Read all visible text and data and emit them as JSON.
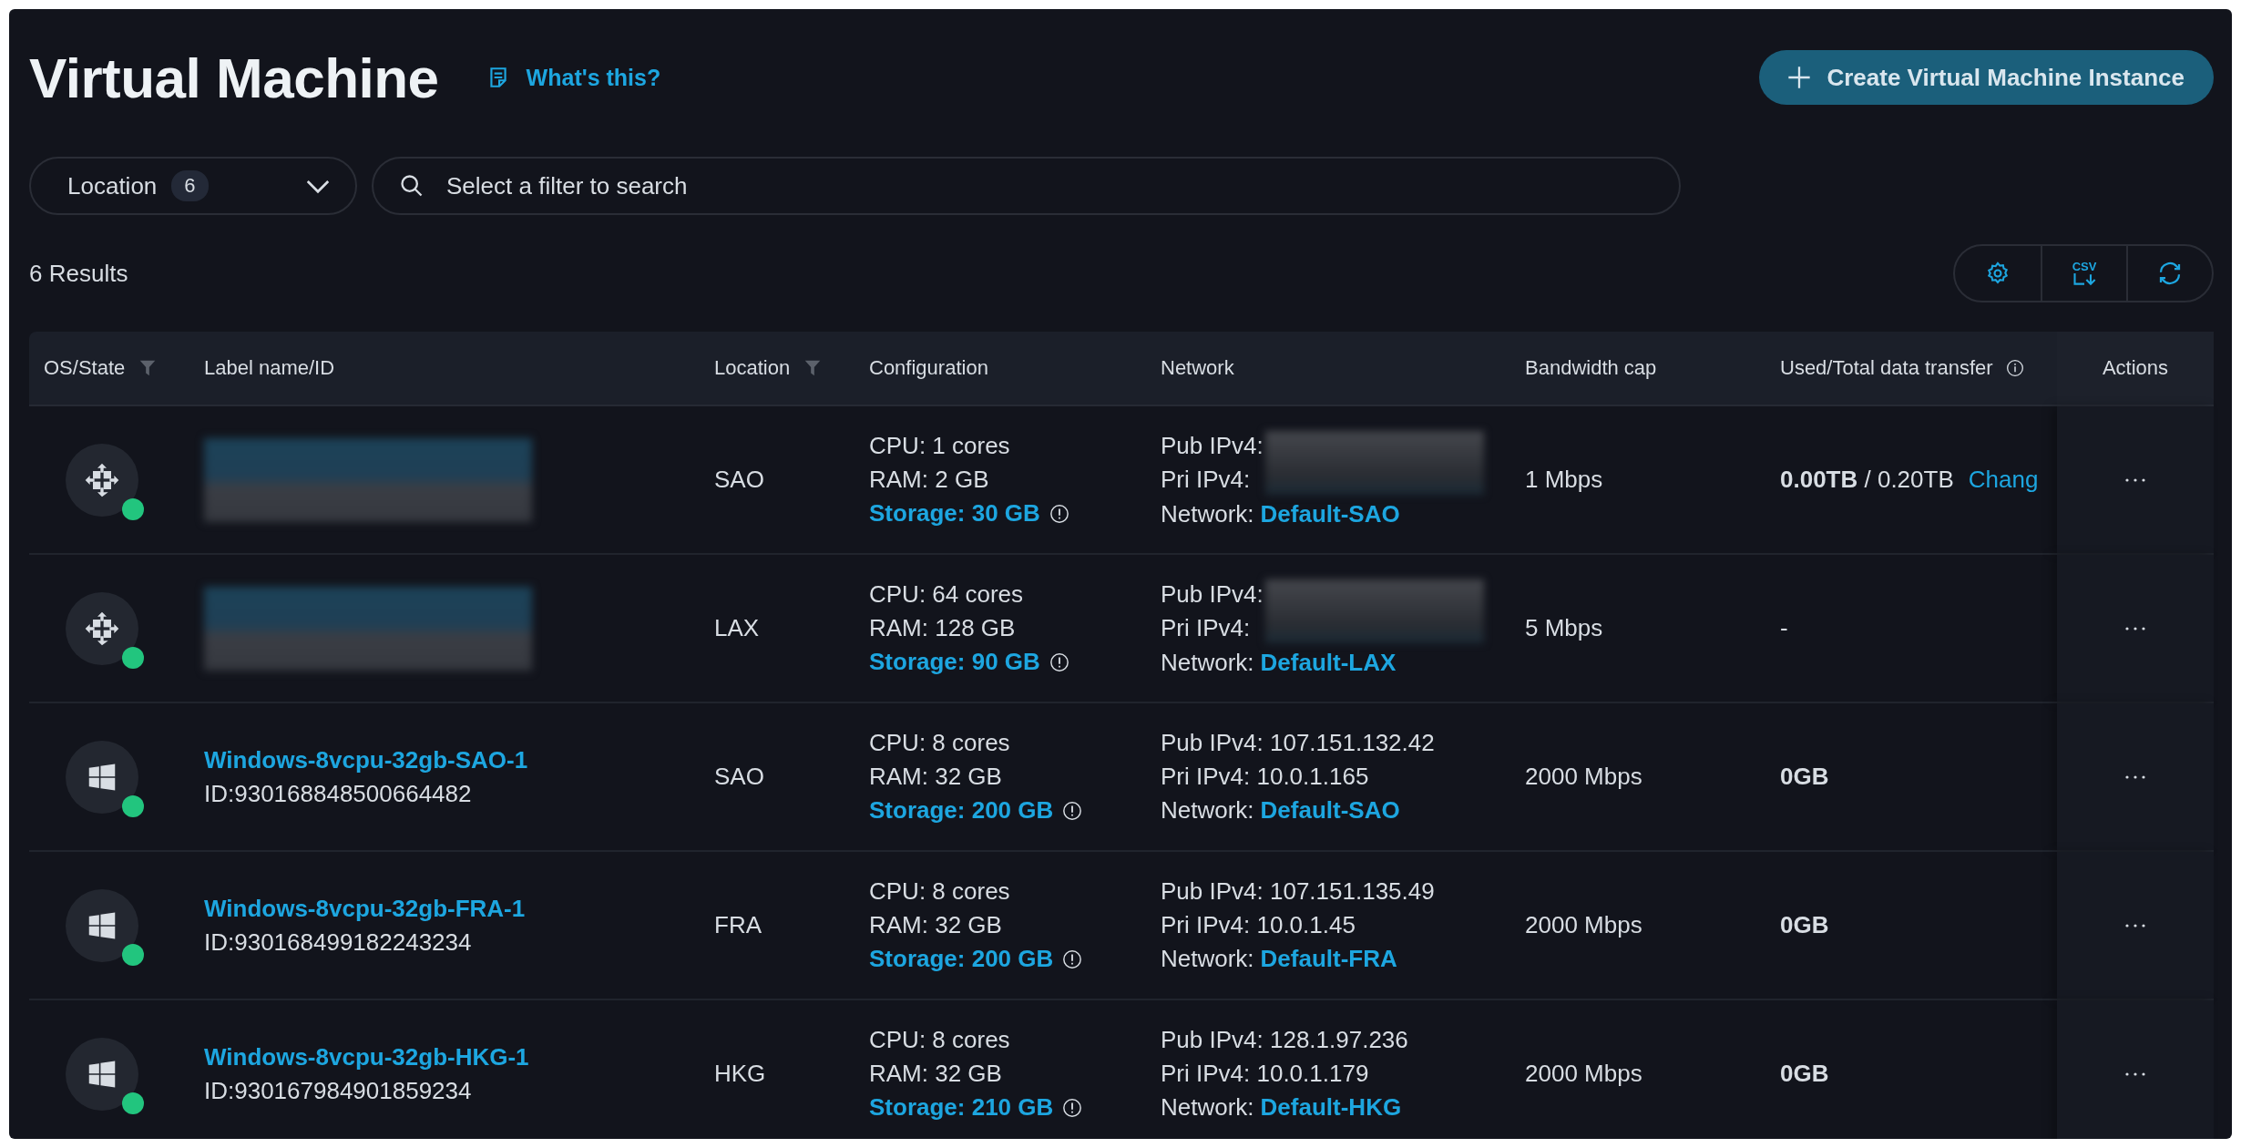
{
  "header": {
    "title": "Virtual Machine",
    "help_link": "What's this?",
    "create_button": "Create Virtual Machine Instance"
  },
  "filters": {
    "location": {
      "label": "Location",
      "count": "6"
    },
    "search": {
      "placeholder": "Select a filter to search"
    }
  },
  "results": "6 Results",
  "toolbar": [
    {
      "kind": "settings"
    },
    {
      "kind": "export",
      "label": "CSV"
    },
    {
      "kind": "refresh"
    }
  ],
  "table": {
    "columns": [
      {
        "label": "OS/State",
        "kind": "filterable"
      },
      {
        "label": "Label name/ID",
        "kind": "plain"
      },
      {
        "label": "Location",
        "kind": "filterable"
      },
      {
        "label": "Configuration",
        "kind": "plain"
      },
      {
        "label": "Network",
        "kind": "plain"
      },
      {
        "label": "Bandwidth cap",
        "kind": "plain"
      },
      {
        "label": "Used/Total data transfer",
        "kind": "explained"
      },
      {
        "label": "Actions",
        "kind": "centered"
      }
    ],
    "rows": [
      {
        "kind": "generic",
        "running": true,
        "name_redacted": true,
        "location": "SAO",
        "cpu": "CPU: 1 cores",
        "ram": "RAM: 2 GB",
        "storage": "Storage: 30 GB",
        "pub_ip": "Pub IPv4:",
        "pri_ip": "Pri IPv4:",
        "ip_redacted": true,
        "network_label": "Network:",
        "network": "Default-SAO",
        "bandwidth": "1 Mbps",
        "transfer": {
          "used": "0.00TB",
          "total": "/ 0.20TB",
          "link": "Chang"
        }
      },
      {
        "kind": "generic",
        "running": true,
        "name_redacted": true,
        "location": "LAX",
        "cpu": "CPU: 64 cores",
        "ram": "RAM: 128 GB",
        "storage": "Storage: 90 GB",
        "pub_ip": "Pub IPv4:",
        "pri_ip": "Pri IPv4:",
        "ip_redacted": true,
        "network_label": "Network:",
        "network": "Default-LAX",
        "bandwidth": "5 Mbps",
        "transfer": {
          "text": "-"
        }
      },
      {
        "kind": "windows",
        "running": true,
        "name_redacted": false,
        "name": "Windows-8vcpu-32gb-SAO-1",
        "id": "ID:930168848500664482",
        "location": "SAO",
        "cpu": "CPU: 8 cores",
        "ram": "RAM: 32 GB",
        "storage": "Storage: 200 GB",
        "pub_ip": "Pub IPv4: 107.151.132.42",
        "pri_ip": "Pri IPv4: 10.0.1.165",
        "ip_redacted": false,
        "network_label": "Network:",
        "network": "Default-SAO",
        "bandwidth": "2000 Mbps",
        "transfer": {
          "used": "0GB"
        }
      },
      {
        "kind": "windows",
        "running": true,
        "name_redacted": false,
        "name": "Windows-8vcpu-32gb-FRA-1",
        "id": "ID:930168499182243234",
        "location": "FRA",
        "cpu": "CPU: 8 cores",
        "ram": "RAM: 32 GB",
        "storage": "Storage: 200 GB",
        "pub_ip": "Pub IPv4: 107.151.135.49",
        "pri_ip": "Pri IPv4: 10.0.1.45",
        "ip_redacted": false,
        "network_label": "Network:",
        "network": "Default-FRA",
        "bandwidth": "2000 Mbps",
        "transfer": {
          "used": "0GB"
        }
      },
      {
        "kind": "windows",
        "running": true,
        "name_redacted": false,
        "name": "Windows-8vcpu-32gb-HKG-1",
        "id": "ID:930167984901859234",
        "location": "HKG",
        "cpu": "CPU: 8 cores",
        "ram": "RAM: 32 GB",
        "storage": "Storage: 210 GB",
        "pub_ip": "Pub IPv4: 128.1.97.236",
        "pri_ip": "Pri IPv4: 10.0.1.179",
        "ip_redacted": false,
        "network_label": "Network:",
        "network": "Default-HKG",
        "bandwidth": "2000 Mbps",
        "transfer": {
          "used": "0GB"
        }
      }
    ]
  }
}
